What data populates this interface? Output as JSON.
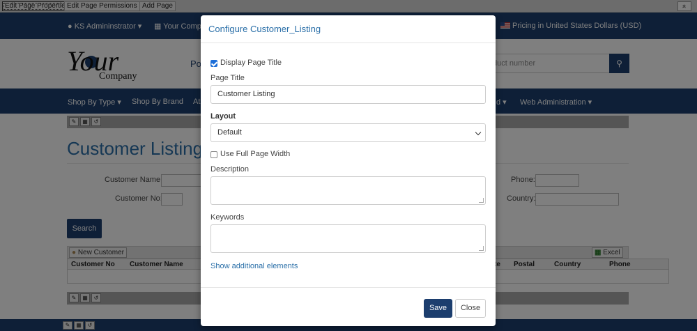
{
  "admin_bar": {
    "edit_properties": "Edit Page Properties",
    "edit_permissions": "Edit Page Permissions",
    "add_page": "Add Page",
    "collapse": "»"
  },
  "top_nav": {
    "user": "KS Admininstrator ▾",
    "company": "Your Compa",
    "pricing": "Pricing in United States Dollars (USD)"
  },
  "header": {
    "logo_your": "Your",
    "logo_company": "Company",
    "link_fragment": "Po",
    "search_placeholder": "duct number"
  },
  "main_nav": {
    "shop_by_type": "Shop By Type ▾",
    "shop_by_brand": "Shop By Brand",
    "fragment_at": "At",
    "fragment_d": "d ▾",
    "web_admin": "Web Administration ▾"
  },
  "page": {
    "title": "Customer Listing",
    "customer_name_label": "Customer Name:",
    "customer_no_label": "Customer No:",
    "phone_label": "Phone:",
    "country_label": "Country:",
    "search_button": "Search",
    "new_customer": "New Customer",
    "excel": "Excel",
    "columns": [
      "Customer No",
      "Customer Name",
      "te",
      "Postal",
      "Country",
      "Phone"
    ]
  },
  "modal": {
    "title": "Configure Customer_Listing",
    "display_title_label": "Display Page Title",
    "page_title_label": "Page Title",
    "page_title_value": "Customer Listing",
    "layout_label": "Layout",
    "layout_value": "Default",
    "full_width_label": "Use Full Page Width",
    "description_label": "Description",
    "keywords_label": "Keywords",
    "show_more": "Show additional elements",
    "save": "Save",
    "close": "Close"
  },
  "colors": {
    "brand_navy": "#1c3e6e",
    "link_blue": "#2a6fa8"
  }
}
